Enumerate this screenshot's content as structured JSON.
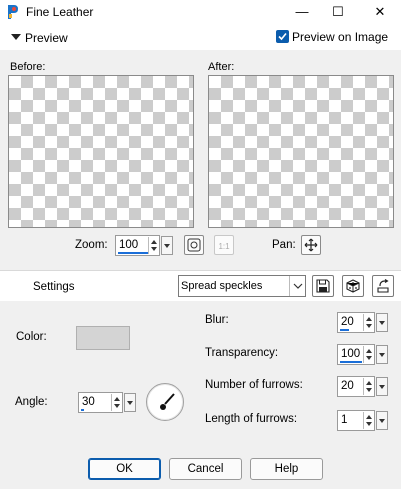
{
  "window": {
    "title": "Fine Leather",
    "minimize_glyph": "—",
    "maximize_glyph": "☐",
    "close_glyph": "✕"
  },
  "preview": {
    "section_label": "Preview",
    "preview_on_image_label": "Preview on Image",
    "preview_on_image_checked": true,
    "before_label": "Before:",
    "after_label": "After:",
    "zoom_label": "Zoom:",
    "zoom_value": "100",
    "pan_label": "Pan:"
  },
  "settings": {
    "label": "Settings",
    "preset_value": "Spread speckles"
  },
  "params": {
    "color_label": "Color:",
    "color_value": "#d4d4d4",
    "angle_label": "Angle:",
    "angle_value": "30",
    "blur_label": "Blur:",
    "blur_value": "20",
    "transparency_label": "Transparency:",
    "transparency_value": "100",
    "furrows_label": "Number of furrows:",
    "furrows_value": "20",
    "length_label": "Length of furrows:",
    "length_value": "1"
  },
  "buttons": {
    "ok": "OK",
    "cancel": "Cancel",
    "help": "Help"
  },
  "colors": {
    "accent": "#0b5cad",
    "checker_dark": "#cccccc"
  }
}
